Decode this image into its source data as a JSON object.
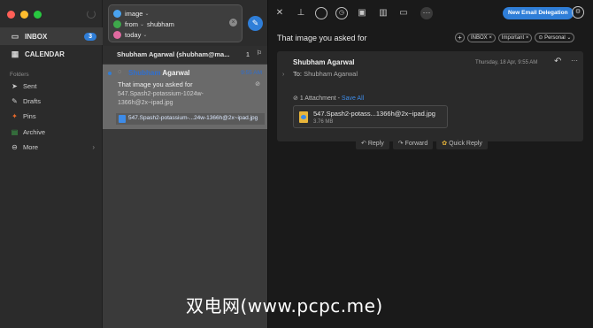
{
  "colors": {
    "accent": "#2f7ed8",
    "close": "#ff5f57",
    "minimize": "#febc2e",
    "zoom": "#28c840",
    "pins": "#e8692a",
    "archive": "#3ea84b"
  },
  "sidebar": {
    "inbox": {
      "label": "INBOX",
      "count": "3",
      "icon": "inbox-icon"
    },
    "calendar": {
      "label": "CALENDAR",
      "icon": "calendar-icon"
    },
    "folders_title": "Folders",
    "folders": [
      {
        "label": "Sent",
        "icon": "send-icon"
      },
      {
        "label": "Drafts",
        "icon": "drafts-icon"
      },
      {
        "label": "Pins",
        "icon": "pin-icon"
      },
      {
        "label": "Archive",
        "icon": "archive-icon"
      },
      {
        "label": "More",
        "icon": "more-icon"
      }
    ]
  },
  "search": {
    "chips": [
      {
        "label": "image",
        "color": "#4aa3f0"
      },
      {
        "label": "from",
        "value": "shubham",
        "color": "#3ea84b"
      },
      {
        "label": "today",
        "color": "#e06aa0"
      }
    ]
  },
  "thread": {
    "title": "Shubham Agarwal (shubham@ma...",
    "count": "1"
  },
  "message_item": {
    "sender_highlight": "Shubham",
    "sender_rest": " Agarwal",
    "time": "9:55 AM",
    "subject": "That image you asked for",
    "preview": "547.Spash2-potassium-1024w-1366h@2x~ipad.jpg",
    "attachment": "547.Spash2-potassium-...24w-1366h@2x~ipad.jpg"
  },
  "reader": {
    "delegation_label": "New Email Delegation",
    "subject": "That image you asked for",
    "tags": [
      "INBOX",
      "Important",
      "Personal"
    ],
    "from": "Shubham Agarwal",
    "to_label": "To:",
    "to_name": "Shubham Agarwal",
    "date": "Thursday, 18 Apr, 9:55 AM",
    "attachment_summary": "1 Attachment",
    "save_all": "Save All",
    "attachment_name": "547.Spash2-potass...1366h@2x~ipad.jpg",
    "attachment_size": "3.76 MB",
    "actions": [
      "Reply",
      "Forward",
      "Quick Reply"
    ]
  },
  "watermark": "双电网(www.pcpc.me)"
}
